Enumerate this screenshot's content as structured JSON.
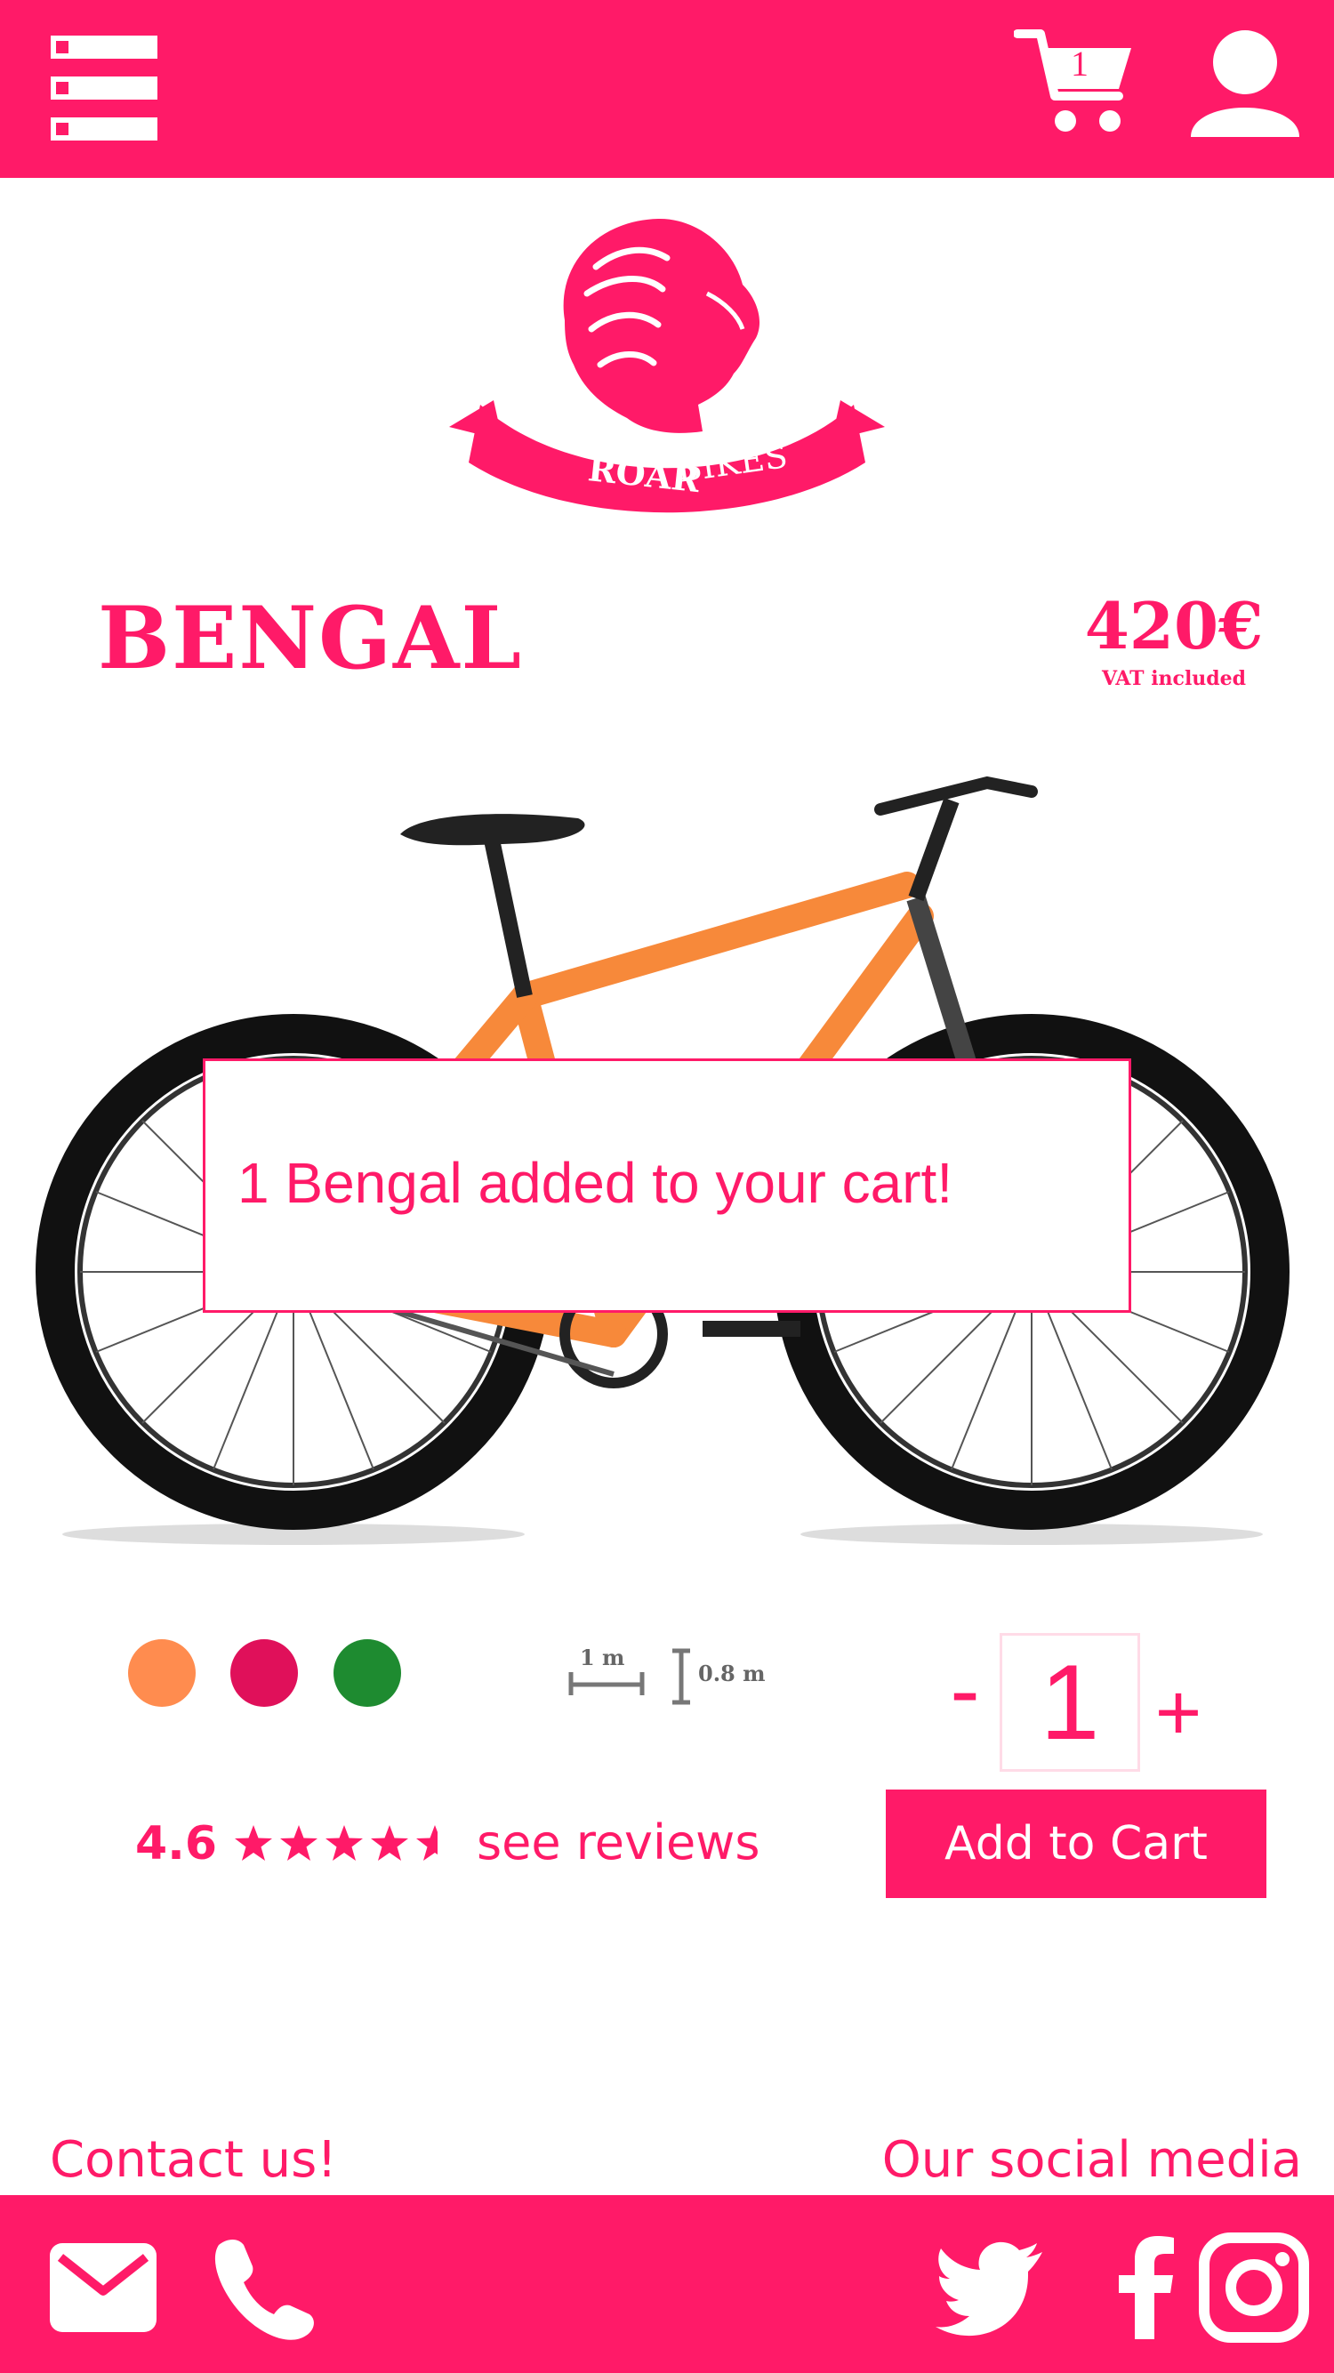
{
  "brand": {
    "primary": "#ff1a68",
    "logo_text_1": "ROAR",
    "logo_text_2": "BIKES"
  },
  "header": {
    "cart_count": "1"
  },
  "product": {
    "name": "BENGAL",
    "price": "420€",
    "vat_note": "VAT included",
    "colors": [
      "#ff8c4f",
      "#e0105a",
      "#1e8b30"
    ],
    "dims": {
      "length": "1 m",
      "height": "0.8 m"
    }
  },
  "toast": {
    "message": "1 Bengal added to your cart!"
  },
  "purchase": {
    "minus": "-",
    "quantity": "1",
    "plus": "+",
    "add_label": "Add to Cart"
  },
  "rating": {
    "value": "4.6",
    "stars": 4.6,
    "link": "see reviews"
  },
  "footer": {
    "contact_label": "Contact us!",
    "social_label": "Our social media"
  },
  "icons": [
    "menu-icon",
    "cart-icon",
    "account-icon",
    "mail-icon",
    "phone-icon",
    "twitter-icon",
    "facebook-icon",
    "instagram-icon"
  ]
}
